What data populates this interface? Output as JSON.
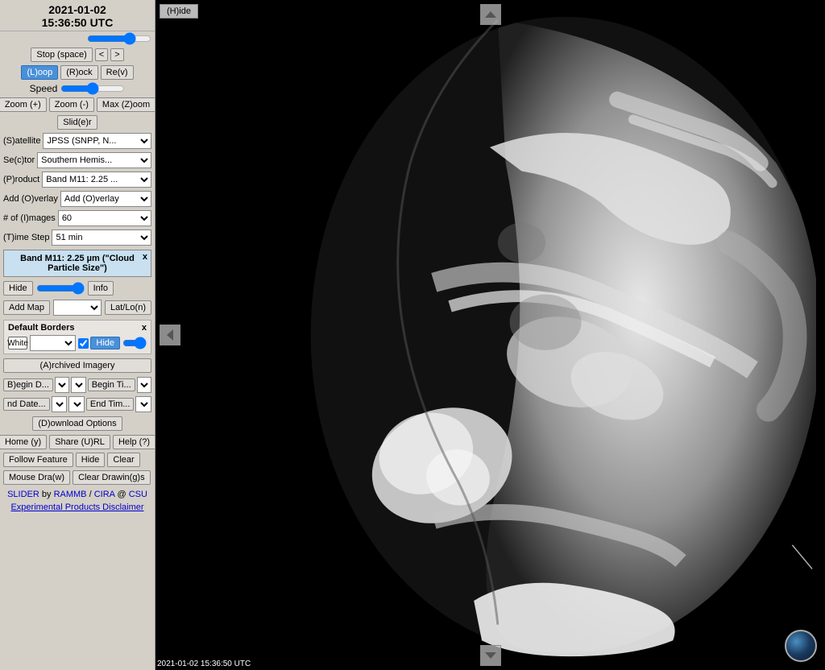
{
  "sidebar": {
    "datetime": "2021-01-02\n15:36:50 UTC",
    "datetime_line1": "2021-01-02",
    "datetime_line2": "15:36:50 UTC",
    "stop_btn": "Stop (space)",
    "prev_btn": "<",
    "next_btn": ">",
    "loop_btn": "(L)oop",
    "rock_btn": "(R)ock",
    "rev_btn": "Re(v)",
    "speed_label": "Speed",
    "zoom_in_btn": "Zoom (+)",
    "zoom_out_btn": "Zoom (-)",
    "max_zoom_btn": "Max (Z)oom",
    "slider_btn": "Slid(e)r",
    "satellite_label": "(S)atellite",
    "satellite_value": "JPSS (SNPP, N...",
    "sector_label": "Se(c)tor",
    "sector_value": "Southern Hemis...",
    "product_label": "(P)roduct",
    "product_value": "Band M11: 2.25 ...",
    "overlay_label": "Add (O)verlay",
    "overlay_value": "Add (O)verlay",
    "images_label": "# of (I)mages",
    "images_value": "60",
    "timestep_label": "(T)ime Step",
    "timestep_value": "51 min",
    "band_info": "Band M11: 2.25 µm (\"Cloud Particle Size\")",
    "band_close": "x",
    "hide_btn": "Hide",
    "info_btn": "Info",
    "add_map_btn": "Add Map",
    "latlng_btn": "Lat/Lo(n)",
    "borders_title": "Default Borders",
    "borders_close": "x",
    "borders_color": "White",
    "borders_hide_label": "Hide",
    "archived_btn": "(A)rchived Imagery",
    "begin_date_label": "B)egin D...",
    "begin_time_label": "Begin Ti...",
    "end_date_label": "nd Date...",
    "end_time_label": "End Tim...",
    "download_btn": "(D)ownload Options",
    "home_btn": "Home (y)",
    "share_btn": "Share (U)RL",
    "help_btn": "Help (?)",
    "follow_btn": "Follow Feature",
    "feature_hide_btn": "Hide",
    "clear_btn": "Clear",
    "mouse_draw_btn": "Mouse Dra(w)",
    "clear_drawing_btn": "Clear Drawin(g)s",
    "footer_slider": "SLIDER",
    "footer_by": " by ",
    "footer_rammb": "RAMMB",
    "footer_slash": " / ",
    "footer_cira": "CIRA",
    "footer_at": " @ ",
    "footer_csu": "CSU",
    "experimental_link": "Experimental Products Disclaimer"
  },
  "main": {
    "hide_panel": "(H)ide",
    "bottom_timestamp": "2021-01-02 15:36:50 UTC",
    "nav_up": "˄",
    "nav_down": "˅",
    "nav_left": "«"
  }
}
